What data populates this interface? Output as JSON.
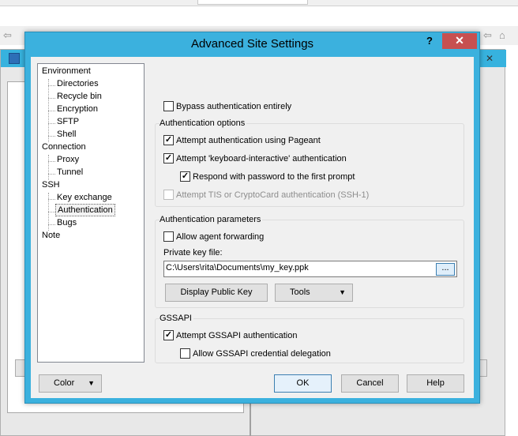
{
  "dialog": {
    "title": "Advanced Site Settings",
    "help_label": "?",
    "close_label": "✕"
  },
  "tree": {
    "items": [
      {
        "label": "Environment",
        "level": 0
      },
      {
        "label": "Directories",
        "level": 1
      },
      {
        "label": "Recycle bin",
        "level": 1
      },
      {
        "label": "Encryption",
        "level": 1
      },
      {
        "label": "SFTP",
        "level": 1
      },
      {
        "label": "Shell",
        "level": 1
      },
      {
        "label": "Connection",
        "level": 0
      },
      {
        "label": "Proxy",
        "level": 1
      },
      {
        "label": "Tunnel",
        "level": 1
      },
      {
        "label": "SSH",
        "level": 0
      },
      {
        "label": "Key exchange",
        "level": 1
      },
      {
        "label": "Authentication",
        "level": 1,
        "selected": true
      },
      {
        "label": "Bugs",
        "level": 1
      },
      {
        "label": "Note",
        "level": 0
      }
    ]
  },
  "bypass": {
    "label": "Bypass authentication entirely",
    "checked": false
  },
  "auth_options": {
    "title": "Authentication options",
    "pageant": {
      "label": "Attempt authentication using Pageant",
      "checked": true
    },
    "keyboard": {
      "label": "Attempt 'keyboard-interactive' authentication",
      "checked": true
    },
    "respond": {
      "label": "Respond with password to the first prompt",
      "checked": true
    },
    "tis": {
      "label": "Attempt TIS or CryptoCard authentication (SSH-1)",
      "checked": false,
      "disabled": true
    }
  },
  "auth_params": {
    "title": "Authentication parameters",
    "agent_forwarding": {
      "label": "Allow agent forwarding",
      "checked": false
    },
    "private_key_label": "Private key file:",
    "private_key_value": "C:\\Users\\rita\\Documents\\my_key.ppk",
    "browse_label": "...",
    "display_public_key": "Display Public Key",
    "tools": "Tools"
  },
  "gssapi": {
    "title": "GSSAPI",
    "attempt": {
      "label": "Attempt GSSAPI authentication",
      "checked": true
    },
    "delegation": {
      "label": "Allow GSSAPI credential delegation",
      "checked": false
    }
  },
  "footer": {
    "color": "Color",
    "ok": "OK",
    "cancel": "Cancel",
    "help": "Help"
  },
  "icons": {
    "check": "✓",
    "dropdown": "▼",
    "back": "⇦",
    "home": "⌂",
    "close": "✕"
  },
  "colors": {
    "titlebar": "#3bb1de",
    "close_button": "#c75050"
  }
}
